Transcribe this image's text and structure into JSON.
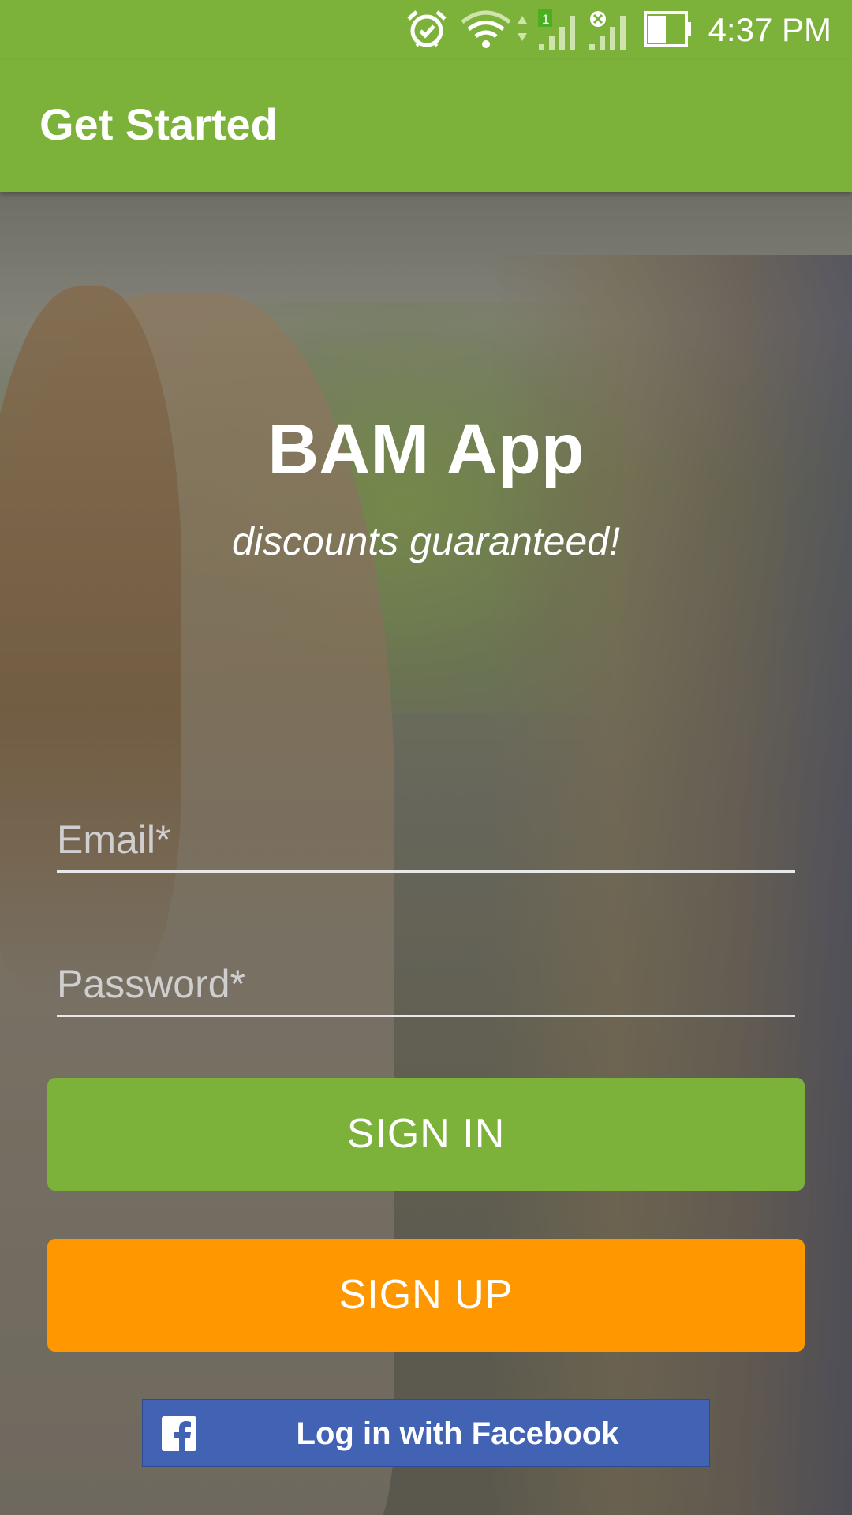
{
  "status_bar": {
    "time": "4:37 PM",
    "icons": [
      "alarm-icon",
      "wifi-icon",
      "cell-signal-icon",
      "cell-signal-no-service-icon",
      "battery-icon"
    ]
  },
  "app_bar": {
    "title": "Get Started",
    "color": "#7cb23a"
  },
  "hero": {
    "app_name": "BAM App",
    "tagline": "discounts guaranteed!"
  },
  "form": {
    "email_placeholder": "Email*",
    "email_value": "",
    "password_placeholder": "Password*",
    "password_value": ""
  },
  "buttons": {
    "sign_in": "SIGN IN",
    "sign_up": "SIGN UP",
    "facebook": "Log in with Facebook"
  },
  "colors": {
    "primary_green": "#7cb23a",
    "signup_orange": "#ff9800",
    "facebook_blue": "#4262b4"
  }
}
